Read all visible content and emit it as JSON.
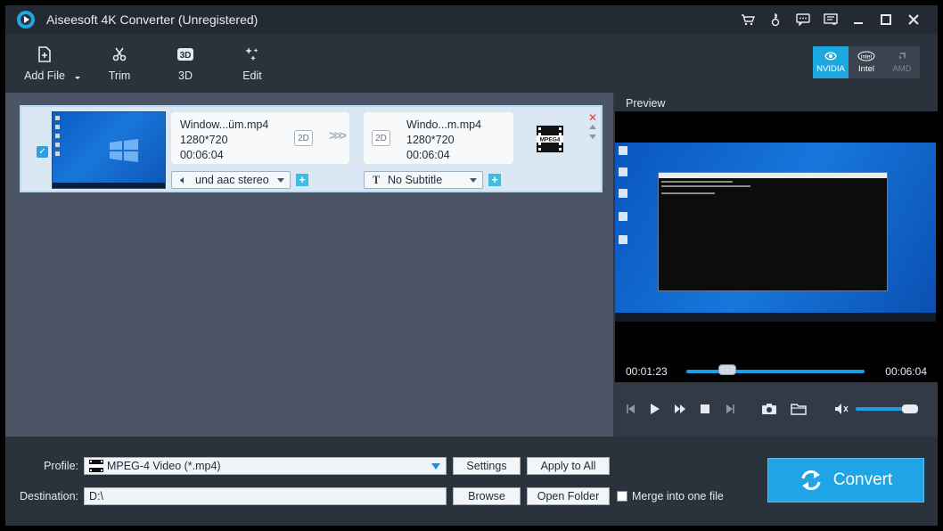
{
  "window": {
    "title": "Aiseesoft 4K Converter (Unregistered)"
  },
  "toolbar": {
    "add_file": "Add File",
    "trim": "Trim",
    "three_d": "3D",
    "edit": "Edit",
    "gpu": {
      "nvidia": "NVIDIA",
      "intel": "Intel",
      "amd": "AMD"
    }
  },
  "file_item": {
    "checked": true,
    "source": {
      "name": "Window...üm.mp4",
      "resolution": "1280*720",
      "duration": "00:06:04",
      "mode": "2D"
    },
    "output": {
      "name": "Windo...m.mp4",
      "resolution": "1280*720",
      "duration": "00:06:04",
      "mode": "2D"
    },
    "format_icon": "MPEG4",
    "audio_track": "und aac stereo",
    "subtitle": "No Subtitle"
  },
  "preview": {
    "label": "Preview",
    "current_time": "00:01:23",
    "total_time": "00:06:04",
    "progress": 0.23,
    "volume": 0.9
  },
  "bottom": {
    "profile_label": "Profile:",
    "profile_value": "MPEG-4 Video (*.mp4)",
    "settings_button": "Settings",
    "apply_all_button": "Apply to All",
    "destination_label": "Destination:",
    "destination_value": "D:\\",
    "browse_button": "Browse",
    "open_folder_button": "Open Folder",
    "merge_label": "Merge into one file",
    "merge_checked": false,
    "convert_button": "Convert"
  },
  "colors": {
    "accent": "#1fa4e6",
    "background": "#2f3844",
    "list_area": "#4b5565"
  }
}
